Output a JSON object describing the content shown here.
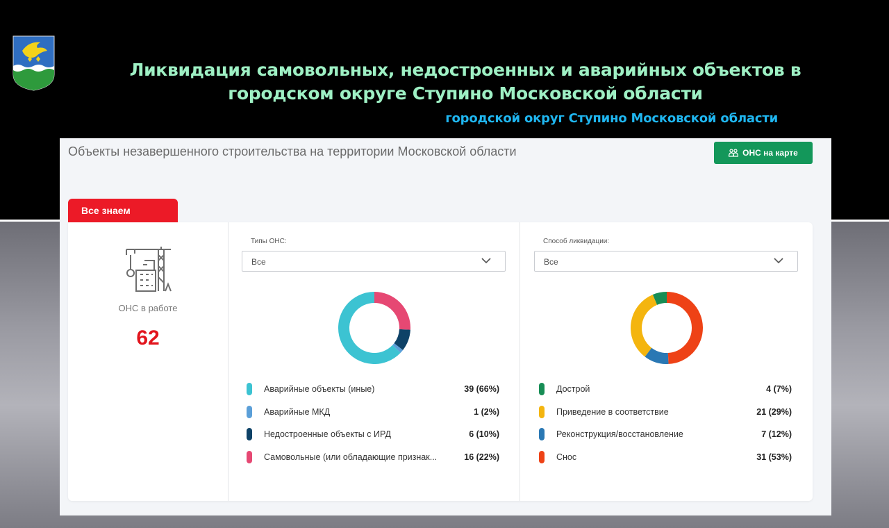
{
  "slide": {
    "title": "Ликвидация самовольных, недостроенных и аварийных объектов в городском округе Ступино Московской области",
    "subtitle": "городской округ Ступино Московской области"
  },
  "header": {
    "title": "Объекты незавершенного строительства на территории Московской области",
    "map_button_label": "ОНС на карте",
    "map_button_icon": "map-people-icon"
  },
  "tab": {
    "label": "Все знаем"
  },
  "summary": {
    "icon": "construction-crane-icon",
    "label": "ОНС в работе",
    "value": "62"
  },
  "panels": [
    {
      "filter_label": "Типы ОНС:",
      "selected": "Все",
      "chart_data": {
        "type": "pie",
        "style": "donut",
        "categories": [
          "Аварийные объекты (иные)",
          "Аварийные МКД",
          "Недостроенные объекты с ИРД",
          "Самовольные (или обладающие признак..."
        ],
        "values": [
          39,
          1,
          6,
          16
        ],
        "percents": [
          66,
          2,
          10,
          22
        ],
        "colors": [
          "#3cc3d2",
          "#5b9fd8",
          "#0e4267",
          "#e64873"
        ]
      },
      "legend": [
        {
          "label": "Аварийные объекты (иные)",
          "value": "39 (66%)",
          "color": "#3cc3d2"
        },
        {
          "label": "Аварийные МКД",
          "value": "1 (2%)",
          "color": "#5b9fd8"
        },
        {
          "label": "Недостроенные объекты с ИРД",
          "value": "6 (10%)",
          "color": "#0e4267"
        },
        {
          "label": "Самовольные (или обладающие признак...",
          "value": "16 (22%)",
          "color": "#e64873"
        }
      ]
    },
    {
      "filter_label": "Способ ликвидации:",
      "selected": "Все",
      "chart_data": {
        "type": "pie",
        "style": "donut",
        "categories": [
          "Дострой",
          "Приведение в соответствие",
          "Реконструкция/восстановление",
          "Снос"
        ],
        "values": [
          4,
          21,
          7,
          31
        ],
        "percents": [
          7,
          29,
          12,
          53
        ],
        "colors": [
          "#178d55",
          "#f4b50f",
          "#2a78b4",
          "#ee4216"
        ]
      },
      "legend": [
        {
          "label": "Дострой",
          "value": "4 (7%)",
          "color": "#178d55"
        },
        {
          "label": "Приведение в соответствие",
          "value": "21 (29%)",
          "color": "#f4b50f"
        },
        {
          "label": "Реконструкция/восстановление",
          "value": "7 (12%)",
          "color": "#2a78b4"
        },
        {
          "label": "Снос",
          "value": "31 (53%)",
          "color": "#ee4216"
        }
      ]
    }
  ]
}
